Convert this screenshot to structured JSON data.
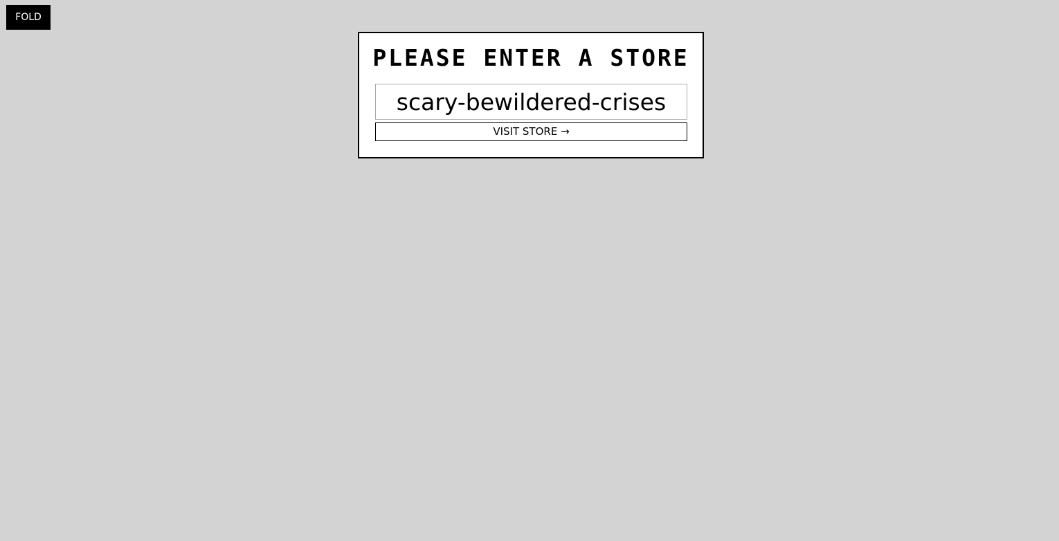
{
  "fold_button": {
    "label": "FOLD"
  },
  "store_panel": {
    "title": "Please enter a store",
    "store_input": {
      "value": "scary-bewildered-crises",
      "placeholder": ""
    },
    "visit_button": {
      "label": "VISIT STORE →"
    }
  },
  "colors": {
    "background": "#d3d3d3",
    "panel_background": "#ffffff",
    "fold_button_background": "#000000",
    "fold_button_text": "#ffffff"
  }
}
